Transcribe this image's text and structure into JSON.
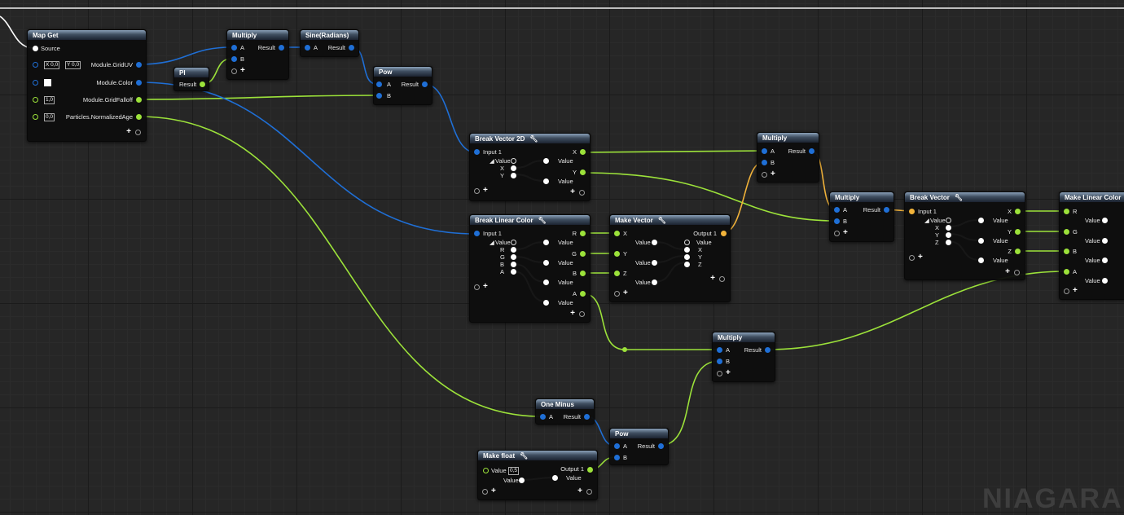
{
  "nodes": {
    "map_get": {
      "title": "Map Get",
      "source": "Source",
      "pins": [
        "Module.GridUV",
        "Module.Color",
        "Module.GridFalloff",
        "Particles.NormalizedAge"
      ],
      "x_label": "X",
      "x_value": "0,0",
      "y_label": "Y",
      "y_value": "0,0",
      "falloff_value": "1,0",
      "age_value": "0,0"
    },
    "pi": {
      "title": "PI",
      "output": "Result"
    },
    "multiply_1": {
      "title": "Multiply",
      "a": "A",
      "b": "B",
      "result": "Result"
    },
    "sine": {
      "title": "Sine(Radians)",
      "a": "A",
      "result": "Result"
    },
    "pow_1": {
      "title": "Pow",
      "a": "A",
      "b": "B",
      "result": "Result"
    },
    "break_vector_2d": {
      "title": "Break Vector 2D",
      "input": "Input 1",
      "value": "Value",
      "x": "X",
      "y": "Y",
      "out_x": "X",
      "out_y": "Y",
      "out_value_1": "Value",
      "out_value_2": "Value"
    },
    "multiply_2": {
      "title": "Multiply",
      "a": "A",
      "b": "B",
      "result": "Result"
    },
    "break_linear_color": {
      "title": "Break Linear Color",
      "input": "Input 1",
      "value": "Value",
      "r": "R",
      "g": "G",
      "b": "B",
      "a": "A",
      "outputs": [
        "R",
        "Value",
        "G",
        "Value",
        "B",
        "Value",
        "A",
        "Value"
      ]
    },
    "make_vector": {
      "title": "Make Vector",
      "inputs": [
        "X",
        "Value",
        "Y",
        "Value",
        "Z",
        "Value"
      ],
      "output": "Output 1",
      "value": "Value",
      "x": "X",
      "y": "Y",
      "z": "Z"
    },
    "multiply_3": {
      "title": "Multiply",
      "a": "A",
      "b": "B",
      "result": "Result"
    },
    "break_vector": {
      "title": "Break Vector",
      "input": "Input 1",
      "value": "Value",
      "x": "X",
      "y": "Y",
      "z": "Z",
      "outputs": [
        "X",
        "Value",
        "Y",
        "Value",
        "Z",
        "Value"
      ]
    },
    "make_linear_color": {
      "title": "Make Linear Color",
      "inputs": [
        "R",
        "Value",
        "G",
        "Value",
        "B",
        "Value",
        "A",
        "Value"
      ]
    },
    "multiply_4": {
      "title": "Multiply",
      "a": "A",
      "b": "B",
      "result": "Result"
    },
    "one_minus": {
      "title": "One Minus",
      "a": "A",
      "result": "Result"
    },
    "pow_2": {
      "title": "Pow",
      "a": "A",
      "b": "B",
      "result": "Result"
    },
    "make_float": {
      "title": "Make float",
      "value_label": "Value",
      "value": "0,5",
      "value_2": "Value",
      "output": "Output 1",
      "out_value": "Value"
    }
  },
  "colors": {
    "float_pin": "#9ce23a",
    "vector_pin": "#1f6fd6",
    "color_pin": "#f2b33a",
    "background": "#262626"
  },
  "icons": {
    "wrench": "wrench-icon",
    "add": "add-pin-icon"
  },
  "watermark": "NIAGARA"
}
